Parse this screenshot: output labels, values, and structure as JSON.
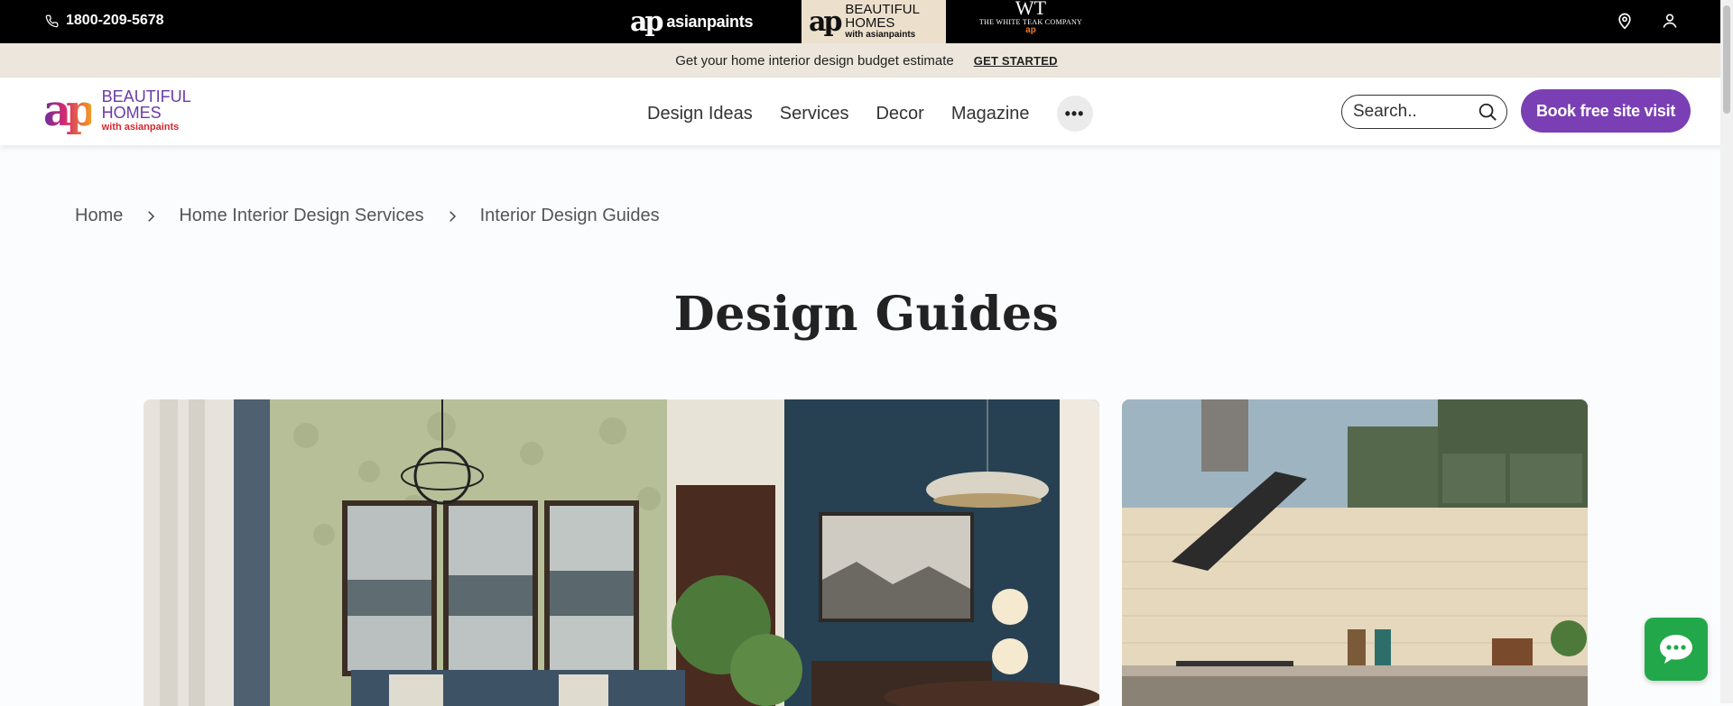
{
  "topbar": {
    "phone": "1800-209-5678",
    "brands": {
      "asianpaints": "asianpaints",
      "beautiful_homes_line1": "BEAUTIFUL",
      "beautiful_homes_line2": "HOMES",
      "beautiful_homes_tagline": "with asianpaints",
      "white_teak_monogram": "WT",
      "white_teak_name": "THE WHITE TEAK COMPANY"
    },
    "icons": [
      "phone-icon",
      "location-pin-icon",
      "user-icon"
    ]
  },
  "promo": {
    "text": "Get your home interior design budget estimate",
    "cta": "GET STARTED"
  },
  "nav": {
    "logo_line1": "BEAUTIFUL",
    "logo_line2": "HOMES",
    "logo_tagline": "with asianpaints",
    "menu": [
      {
        "label": "Design Ideas"
      },
      {
        "label": "Services"
      },
      {
        "label": "Decor"
      },
      {
        "label": "Magazine"
      }
    ],
    "more_label": "•••",
    "search_placeholder": "Search..",
    "book_label": "Book free site visit",
    "accent_color": "#7a3fb4"
  },
  "breadcrumb": [
    {
      "label": "Home"
    },
    {
      "label": "Home Interior Design Services"
    },
    {
      "label": "Interior Design Guides"
    }
  ],
  "page": {
    "title": "Design Guides"
  },
  "cards": [
    {
      "subject": "living-dining room interior image"
    },
    {
      "subject": "modular kitchen interior image"
    }
  ],
  "chat": {
    "icon": "chat-bubble-icon",
    "color": "#22a84a"
  }
}
